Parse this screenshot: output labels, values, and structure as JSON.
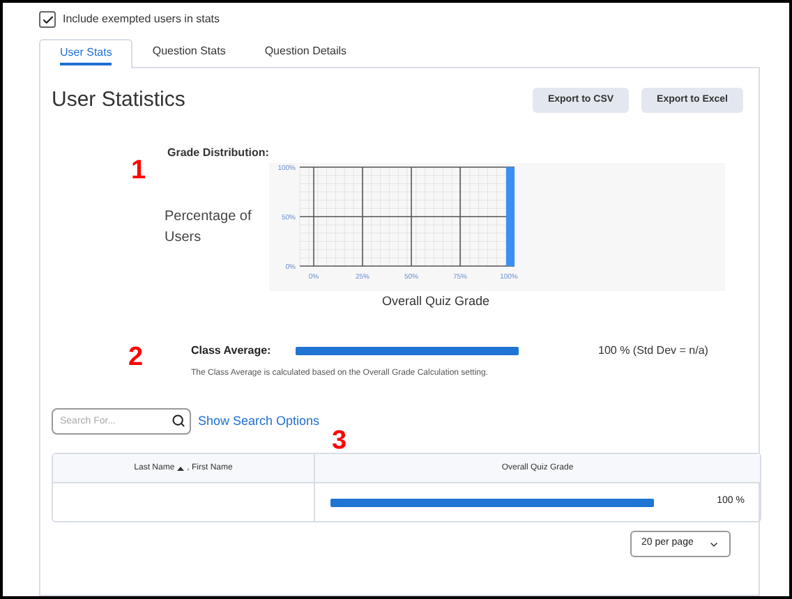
{
  "include_exempted": {
    "label": "Include exempted users in stats",
    "checked": true
  },
  "tabs": [
    {
      "label": "User Stats",
      "selected": true
    },
    {
      "label": "Question Stats",
      "selected": false
    },
    {
      "label": "Question Details",
      "selected": false
    }
  ],
  "title": "User Statistics",
  "buttons": [
    "Export to CSV",
    "Export to Excel"
  ],
  "annotations": [
    "1",
    "2",
    "3"
  ],
  "grade_distribution": {
    "label": "Grade Distribution:",
    "chart_data": {
      "type": "bar",
      "grid": true,
      "xlabel": "Overall Quiz Grade",
      "ylabel": "Percentage of Users",
      "categories": [
        "0%",
        "25%",
        "50%",
        "75%",
        "100%"
      ],
      "values": [
        0,
        0,
        0,
        0,
        100
      ],
      "ylim": [
        0,
        100
      ],
      "yticks": [
        {
          "value": 0,
          "label": "0%"
        },
        {
          "value": 50,
          "label": "50%"
        },
        {
          "value": 100,
          "label": "100%"
        }
      ]
    }
  },
  "class_average": {
    "label": "Class Average:",
    "level": 1,
    "reading": "100 % (Std Dev = n/a)",
    "note": "The Class Average is calculated based on the Overall Grade Calculation setting."
  },
  "search": {
    "placeholder": "Search For...",
    "options_link": "Show Search Options"
  },
  "table": {
    "columns": [
      {
        "sort_field": "Last Name",
        "separator": ",",
        "second_field": "First Name"
      },
      {
        "label": "Overall Quiz Grade"
      }
    ],
    "sort_ascending": true,
    "rows": [
      {
        "level": 1,
        "reading": "100 %"
      }
    ]
  },
  "pagination": {
    "per_page": "20 per page"
  }
}
